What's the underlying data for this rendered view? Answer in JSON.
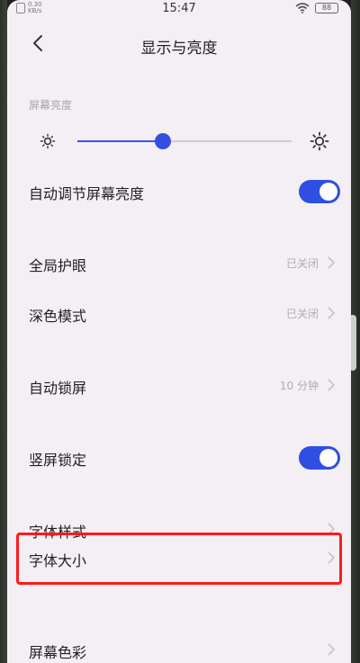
{
  "status_bar": {
    "time": "15:47",
    "net_speed_value": "0.30",
    "net_speed_unit": "KB/s",
    "battery": "88"
  },
  "header": {
    "title": "显示与亮度",
    "back_icon": "chevron-left-icon"
  },
  "brightness": {
    "section_label": "屏幕亮度",
    "level": 0.4
  },
  "rows": {
    "auto_brightness": {
      "label": "自动调节屏幕亮度",
      "toggle_on": true
    },
    "eye_protection": {
      "label": "全局护眼",
      "value": "已关闭"
    },
    "dark_mode": {
      "label": "深色模式",
      "value": "已关闭"
    },
    "auto_lock": {
      "label": "自动锁屏",
      "value": "10 分钟"
    },
    "portrait_lock": {
      "label": "竖屏锁定",
      "toggle_on": true
    },
    "font_style": {
      "label": "字体样式"
    },
    "font_size": {
      "label": "字体大小"
    },
    "screen_color": {
      "label": "屏幕色彩"
    }
  },
  "colors": {
    "accent": "#3350e0",
    "highlight": "#ff1a1a",
    "background": "#f4eff5"
  }
}
